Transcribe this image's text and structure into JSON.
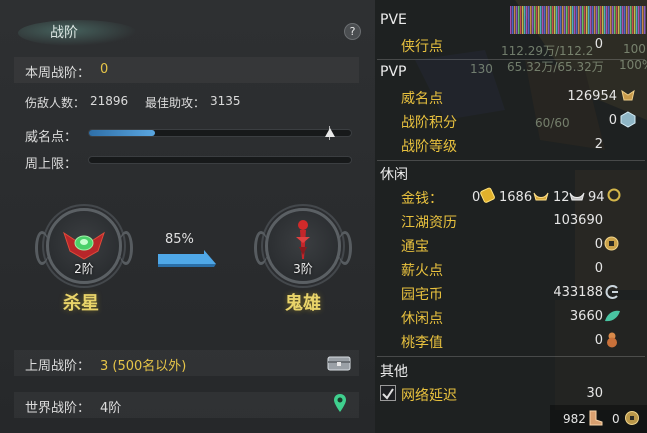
{
  "left": {
    "title": "战阶",
    "help": "?",
    "weekly_rank_label": "本周战阶：",
    "weekly_rank_value": "0",
    "kills_label": "伤敌人数：",
    "kills_value": "21896",
    "assist_label": "最佳助攻：",
    "assist_value": "3135",
    "prestige_label": "威名点：",
    "prestige_progress": 0.25,
    "weekly_cap_label": "周上限：",
    "weekly_cap_progress": 0,
    "current_rank": {
      "level": "2阶",
      "name": "杀星"
    },
    "next_rank": {
      "level": "3阶",
      "name": "鬼雄"
    },
    "progress_pct": "85%",
    "last_week_label": "上周战阶：",
    "last_week_value": "3 (500名以外)",
    "world_rank_label": "世界战阶：",
    "world_rank_value": "4阶",
    "colors": {
      "accent": "#e6c548",
      "bar": "#4f9bd8"
    }
  },
  "right": {
    "pve": {
      "title": "PVE",
      "items": [
        {
          "label": "侠行点",
          "value": "0"
        }
      ]
    },
    "pvp": {
      "title": "PVP",
      "items": [
        {
          "label": "威名点",
          "value": "126954"
        },
        {
          "label": "战阶积分",
          "value": "0"
        },
        {
          "label": "战阶等级",
          "value": "2"
        }
      ]
    },
    "leisure": {
      "title": "休闲",
      "money_label": "金钱：",
      "money_parts": [
        "0",
        "1686",
        "12",
        "94"
      ],
      "items": [
        {
          "label": "江湖资历",
          "value": "103690"
        },
        {
          "label": "通宝",
          "value": "0"
        },
        {
          "label": "薪火点",
          "value": "0"
        },
        {
          "label": "园宅币",
          "value": "433188"
        },
        {
          "label": "休闲点",
          "value": "3660"
        },
        {
          "label": "桃李值",
          "value": "0"
        }
      ]
    },
    "other": {
      "title": "其他",
      "items": [
        {
          "label": "网络延迟",
          "value": "30"
        }
      ]
    },
    "footer": {
      "value1": "982",
      "value2": "0"
    },
    "background_texts": [
      "112.29万/112.2",
      "65.32万/65.32万",
      "130",
      "60/60",
      "100",
      "100%"
    ]
  }
}
